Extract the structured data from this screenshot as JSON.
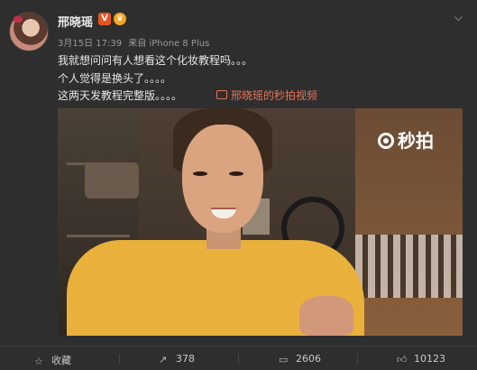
{
  "post": {
    "username": "邢晓瑶",
    "verified_badge": "V",
    "menu_icon": "chevron-down-icon",
    "meta_date": "3月15日 17:39",
    "meta_from": "来自 iPhone 8 Plus",
    "lines": [
      "我就想问问有人想看这个化妆教程吗。。。",
      "个人觉得是换头了。。。。",
      "这两天发教程完整版。。。。"
    ],
    "video_link": "邢晓瑶的秒拍视频",
    "video_watermark": "秒拍"
  },
  "actions": {
    "favorite_label": "收藏",
    "repost_count": "378",
    "comment_count": "2606",
    "like_count": "10123"
  },
  "colors": {
    "accent_link": "#e8735a",
    "badge": "#e8541c"
  }
}
